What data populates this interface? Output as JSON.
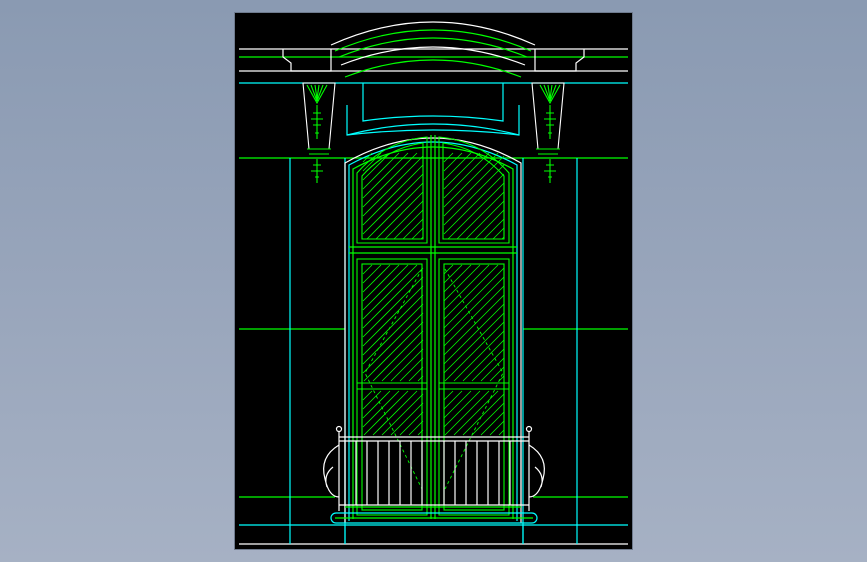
{
  "app": {
    "view": "cad-model-viewport"
  },
  "drawing": {
    "subject": "arched-window-elevation-with-balcony-railing",
    "background_color": "#000000",
    "page_background": "#9aa7bc",
    "layer_colors": {
      "outline": "#ffffff",
      "cornice": "#00ff00",
      "frame": "#00ff00",
      "glazing_hatch": "#00ff00",
      "wall_grid": "#00ffff",
      "course_lines": "#00ff00",
      "railing": "#ffffff",
      "railing_base": "#00ffff"
    },
    "components": [
      "cornice-arch",
      "left-console-bracket",
      "right-console-bracket",
      "transom-sash-left",
      "transom-sash-right",
      "lower-sash-left",
      "lower-sash-right",
      "balcony-railing",
      "wall-course-lines"
    ]
  }
}
